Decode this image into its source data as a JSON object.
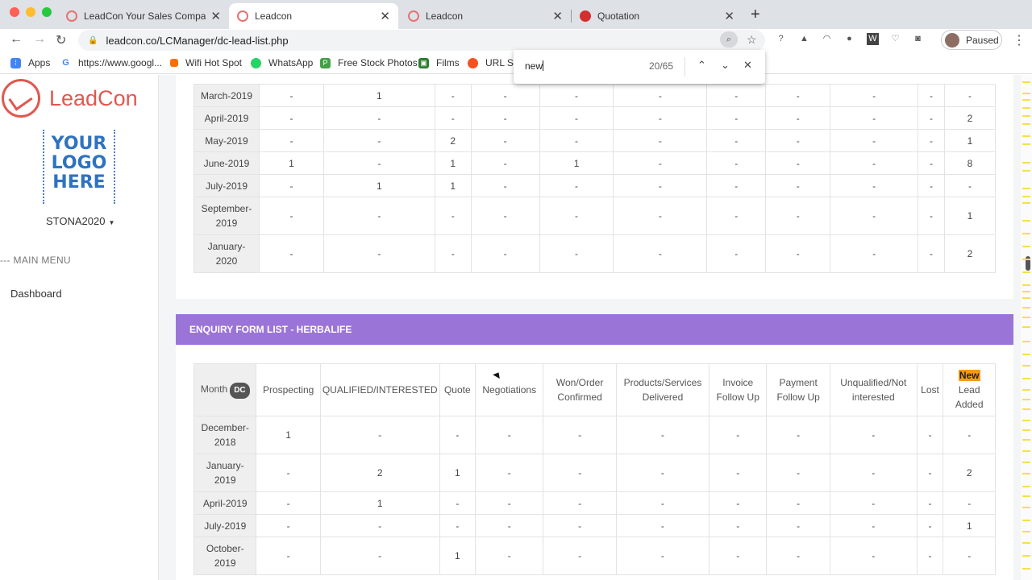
{
  "browser": {
    "tabs": [
      {
        "title": "LeadCon Your Sales Companion",
        "icon": "leadcon-favicon"
      },
      {
        "title": "Leadcon",
        "icon": "leadcon-favicon"
      },
      {
        "title": "Leadcon",
        "icon": "leadcon-favicon"
      },
      {
        "title": "Quotation",
        "icon": "quotation-favicon"
      }
    ],
    "url": "leadcon.co/LCManager/dc-lead-list.php",
    "profile_label": "Paused",
    "bookmarks": [
      "Apps",
      "https://www.googl...",
      "Wifi Hot Spot",
      "WhatsApp",
      "Free Stock Photos",
      "Films",
      "URL Sh"
    ],
    "find": {
      "query": "new",
      "count": "20/65"
    }
  },
  "sidebar": {
    "brand": "LeadCon",
    "logo_lines": [
      "YOUR",
      "LOGO",
      "HERE"
    ],
    "username": "STONA2020",
    "menu_heading": "--- MAIN MENU",
    "menu_items": [
      "Dashboard"
    ]
  },
  "table1": {
    "rows": [
      {
        "month": "March-2019",
        "cells": [
          "-",
          "1",
          "-",
          "-",
          "-",
          "-",
          "-",
          "-",
          "-",
          "-",
          "-"
        ]
      },
      {
        "month": "April-2019",
        "cells": [
          "-",
          "-",
          "-",
          "-",
          "-",
          "-",
          "-",
          "-",
          "-",
          "-",
          "2"
        ]
      },
      {
        "month": "May-2019",
        "cells": [
          "-",
          "-",
          "2",
          "-",
          "-",
          "-",
          "-",
          "-",
          "-",
          "-",
          "1"
        ]
      },
      {
        "month": "June-2019",
        "cells": [
          "1",
          "-",
          "1",
          "-",
          "1",
          "-",
          "-",
          "-",
          "-",
          "-",
          "8"
        ]
      },
      {
        "month": "July-2019",
        "cells": [
          "-",
          "1",
          "1",
          "-",
          "-",
          "-",
          "-",
          "-",
          "-",
          "-",
          "-"
        ]
      },
      {
        "month": "September-2019",
        "cells": [
          "-",
          "-",
          "-",
          "-",
          "-",
          "-",
          "-",
          "-",
          "-",
          "-",
          "1"
        ]
      },
      {
        "month": "January-2020",
        "cells": [
          "-",
          "-",
          "-",
          "-",
          "-",
          "-",
          "-",
          "-",
          "-",
          "-",
          "2"
        ]
      }
    ]
  },
  "table2": {
    "title": "ENQUIRY FORM LIST - HERBALIFE",
    "headers": {
      "month": "Month",
      "dc_badge": "DC",
      "prospecting": "Prospecting",
      "qualified": "QUALIFIED/INTERESTED",
      "quote": "Quote",
      "negotiations": "Negotiations",
      "won": "Won/Order Confirmed",
      "products": "Products/Services Delivered",
      "invoice": "Invoice Follow Up",
      "payment": "Payment Follow Up",
      "unqualified": "Unqualified/Not interested",
      "lost": "Lost",
      "new_word": "New",
      "new_rest": "Lead Added"
    },
    "rows": [
      {
        "month": "December-2018",
        "cells": [
          "1",
          "-",
          "-",
          "-",
          "-",
          "-",
          "-",
          "-",
          "-",
          "-",
          "-"
        ]
      },
      {
        "month": "January-2019",
        "cells": [
          "-",
          "2",
          "1",
          "-",
          "-",
          "-",
          "-",
          "-",
          "-",
          "-",
          "2"
        ]
      },
      {
        "month": "April-2019",
        "cells": [
          "-",
          "1",
          "-",
          "-",
          "-",
          "-",
          "-",
          "-",
          "-",
          "-",
          "-"
        ]
      },
      {
        "month": "July-2019",
        "cells": [
          "-",
          "-",
          "-",
          "-",
          "-",
          "-",
          "-",
          "-",
          "-",
          "-",
          "1"
        ]
      },
      {
        "month": "October-2019",
        "cells": [
          "-",
          "-",
          "1",
          "-",
          "-",
          "-",
          "-",
          "-",
          "-",
          "-",
          "-"
        ]
      }
    ]
  },
  "colors": {
    "accent_purple": "#9b74d8",
    "brand_red": "#e0584f",
    "find_highlight": "#f39c12"
  }
}
